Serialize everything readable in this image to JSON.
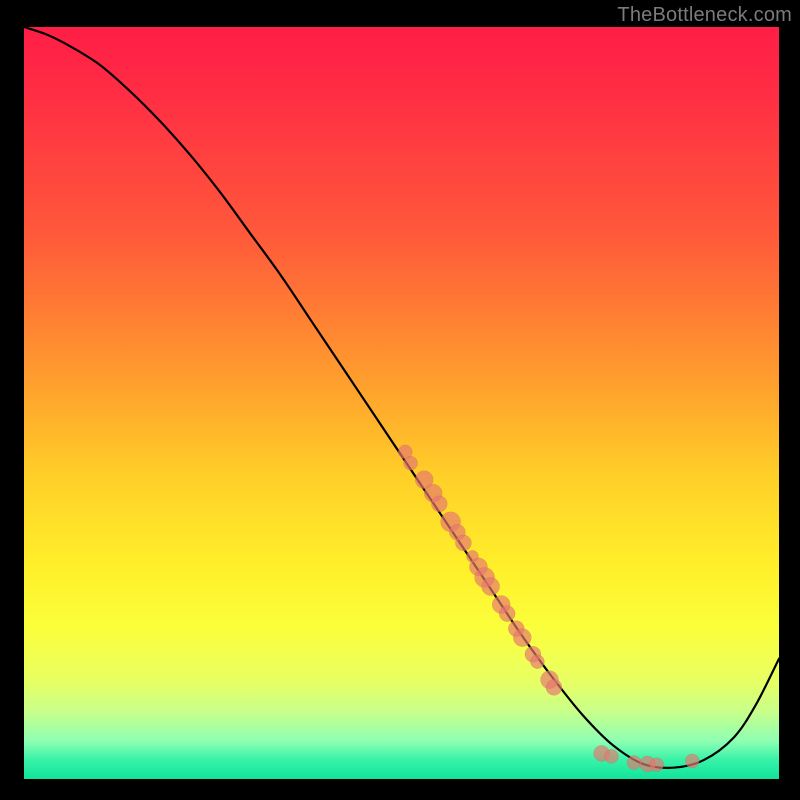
{
  "attribution": "TheBottleneck.com",
  "chart_data": {
    "type": "line",
    "title": "",
    "xlabel": "",
    "ylabel": "",
    "xlim": [
      0,
      100
    ],
    "ylim": [
      0,
      100
    ],
    "grid": false,
    "legend": false,
    "series": [
      {
        "name": "bottleneck-curve",
        "x": [
          0,
          3,
          6,
          10,
          14,
          18,
          22,
          26,
          30,
          34,
          38,
          42,
          46,
          50,
          54,
          58,
          62,
          66,
          70,
          74,
          78,
          82,
          86,
          90,
          94,
          97,
          100
        ],
        "y": [
          100,
          99,
          97.5,
          95,
          91.5,
          87.5,
          83,
          78,
          72.5,
          67,
          61,
          55,
          49,
          43,
          37,
          31,
          25,
          19,
          13.5,
          8.5,
          4.5,
          2,
          1.5,
          2.5,
          5.5,
          10,
          16
        ]
      }
    ],
    "markers": {
      "name": "highlighted-points",
      "color": "#e67870",
      "points": [
        {
          "x": 50.5,
          "y": 43.5,
          "r": 7
        },
        {
          "x": 51.2,
          "y": 42.0,
          "r": 7
        },
        {
          "x": 53.0,
          "y": 39.8,
          "r": 9
        },
        {
          "x": 54.2,
          "y": 38.0,
          "r": 9
        },
        {
          "x": 55.0,
          "y": 36.6,
          "r": 8
        },
        {
          "x": 56.5,
          "y": 34.2,
          "r": 10
        },
        {
          "x": 57.4,
          "y": 32.8,
          "r": 8
        },
        {
          "x": 58.2,
          "y": 31.4,
          "r": 8
        },
        {
          "x": 59.4,
          "y": 29.6,
          "r": 6
        },
        {
          "x": 60.2,
          "y": 28.2,
          "r": 9
        },
        {
          "x": 61.0,
          "y": 26.8,
          "r": 10
        },
        {
          "x": 61.8,
          "y": 25.6,
          "r": 9
        },
        {
          "x": 63.2,
          "y": 23.2,
          "r": 9
        },
        {
          "x": 64.0,
          "y": 22.0,
          "r": 8
        },
        {
          "x": 65.2,
          "y": 20.0,
          "r": 8
        },
        {
          "x": 66.0,
          "y": 18.8,
          "r": 9
        },
        {
          "x": 67.4,
          "y": 16.6,
          "r": 8
        },
        {
          "x": 68.0,
          "y": 15.6,
          "r": 7
        },
        {
          "x": 69.6,
          "y": 13.2,
          "r": 9
        },
        {
          "x": 70.2,
          "y": 12.2,
          "r": 8
        },
        {
          "x": 76.5,
          "y": 3.4,
          "r": 8
        },
        {
          "x": 77.8,
          "y": 3.0,
          "r": 7
        },
        {
          "x": 80.8,
          "y": 2.2,
          "r": 7
        },
        {
          "x": 82.6,
          "y": 2.0,
          "r": 8
        },
        {
          "x": 83.8,
          "y": 1.9,
          "r": 7
        },
        {
          "x": 88.5,
          "y": 2.4,
          "r": 7
        }
      ]
    },
    "background_gradient": {
      "top": "#ff1e46",
      "mid": "#fff02a",
      "bottom": "#12e39b"
    }
  }
}
